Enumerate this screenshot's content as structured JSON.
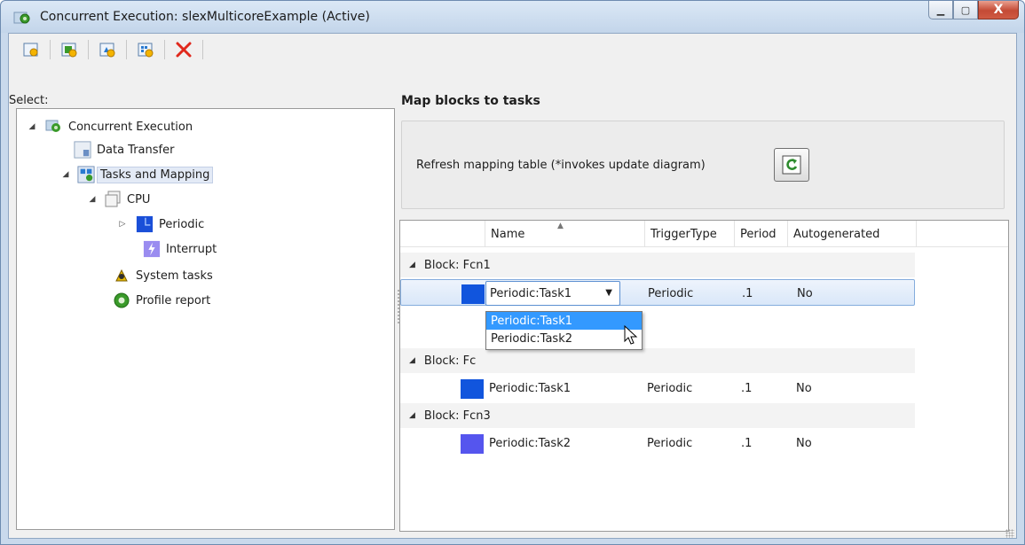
{
  "window": {
    "title": "Concurrent Execution: slexMulticoreExample (Active)",
    "minimize_glyph": "▁",
    "maximize_glyph": "▢",
    "close_glyph": "X"
  },
  "toolbar": {
    "buttons": [
      {
        "icon": "add-task-icon"
      },
      {
        "icon": "add-periodic-icon"
      },
      {
        "icon": "add-trigger-icon"
      },
      {
        "icon": "add-profile-icon"
      },
      {
        "icon": "delete-icon"
      }
    ]
  },
  "left_panel": {
    "header": "Select:",
    "tree": [
      {
        "label": "Concurrent Execution",
        "icon": "gear-icon",
        "expanded": true
      },
      {
        "label": "Data Transfer",
        "icon": "data-transfer-icon"
      },
      {
        "label": "Tasks and Mapping",
        "icon": "tasks-mapping-icon",
        "expanded": true,
        "selected": true
      },
      {
        "label": "CPU",
        "icon": "cpu-icon",
        "expanded": true
      },
      {
        "label": "Periodic",
        "icon": "periodic-icon",
        "expanded": false
      },
      {
        "label": "Interrupt",
        "icon": "interrupt-icon"
      },
      {
        "label": "System tasks",
        "icon": "system-tasks-icon"
      },
      {
        "label": "Profile report",
        "icon": "profile-report-icon"
      }
    ]
  },
  "right_panel": {
    "title": "Map blocks to tasks",
    "refresh_text": "Refresh mapping table (*invokes update diagram)",
    "table": {
      "columns": [
        "Name",
        "TriggerType",
        "Period",
        "Autogenerated"
      ],
      "groups": [
        {
          "label": "Block: Fcn1",
          "row": {
            "name": "Periodic:Task1",
            "trigger": "Periodic",
            "period": ".1",
            "autogenerated": "No",
            "color": "#1155dd"
          }
        },
        {
          "label": "Block: Fc",
          "row": {
            "name": "Periodic:Task1",
            "trigger": "Periodic",
            "period": ".1",
            "autogenerated": "No",
            "color": "#1155dd"
          }
        },
        {
          "label": "Block: Fcn3",
          "row": {
            "name": "Periodic:Task2",
            "trigger": "Periodic",
            "period": ".1",
            "autogenerated": "No",
            "color": "#5555ee"
          }
        }
      ],
      "dropdown_options": [
        "Periodic:Task1",
        "Periodic:Task2"
      ]
    }
  }
}
